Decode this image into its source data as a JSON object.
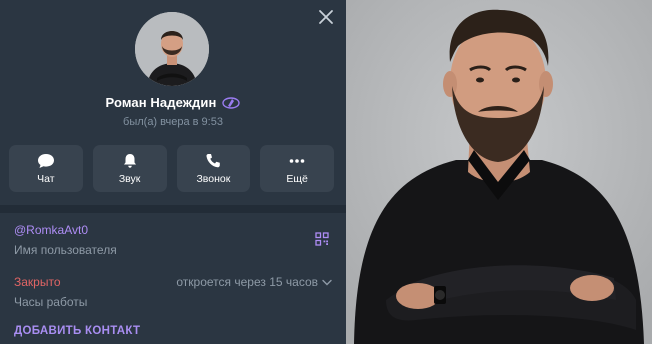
{
  "profile": {
    "name": "Роман Надеждин",
    "status": "был(а) вчера в 9:53",
    "badge_icon": "premium-emoji-icon"
  },
  "actions": [
    {
      "label": "Чат",
      "icon": "chat-icon"
    },
    {
      "label": "Звук",
      "icon": "bell-icon"
    },
    {
      "label": "Звонок",
      "icon": "phone-icon"
    },
    {
      "label": "Ещё",
      "icon": "more-icon"
    }
  ],
  "info": {
    "username": "@RomkaAvt0",
    "username_caption": "Имя пользователя",
    "hours_status": "Закрыто",
    "hours_opens": "откроется через 15 часов",
    "hours_caption": "Часы работы",
    "add_contact": "ДОБАВИТЬ КОНТАКТ"
  },
  "colors": {
    "panel_bg": "#2b3642",
    "accent": "#ae8df5",
    "closed": "#e06565"
  }
}
